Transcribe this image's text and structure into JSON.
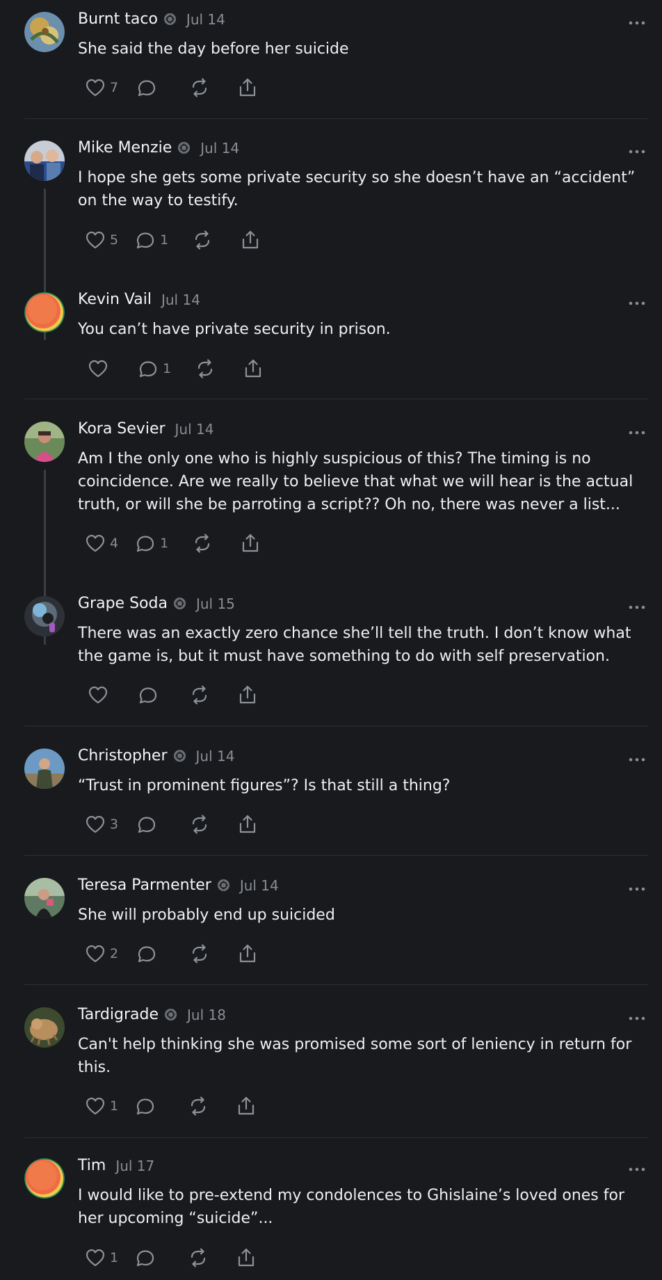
{
  "colors": {
    "background": "#181a1d",
    "text": "#f3f5f7",
    "muted": "#8a8e93",
    "divider": "#2c2f33",
    "thread_line": "#3b3e43"
  },
  "icons": {
    "like": "heart-icon",
    "reply": "comment-bubble-icon",
    "repost": "repost-arrows-icon",
    "share": "share-upload-icon",
    "more": "more-dots-icon",
    "verified": "verified-badge-icon"
  },
  "posts": [
    {
      "name": "Burnt taco",
      "verified": true,
      "date": "Jul 14",
      "body": "She said the day before her suicide",
      "likes": "7",
      "replies": ""
    },
    {
      "name": "Mike Menzie",
      "verified": true,
      "date": "Jul 14",
      "body": "I hope she gets some private security so she doesn’t have an “accident” on the way to testify.",
      "likes": "5",
      "replies": "1"
    },
    {
      "name": "Kevin Vail",
      "verified": false,
      "date": "Jul 14",
      "body": "You can’t have private security in prison.",
      "likes": "",
      "replies": "1"
    },
    {
      "name": "Kora Sevier",
      "verified": false,
      "date": "Jul 14",
      "body": "Am I the only one who is highly suspicious of this? The timing is no coincidence. Are we really to believe that what we will hear is the actual truth, or will she be parroting a script?? Oh no, there was never a list...",
      "likes": "4",
      "replies": "1"
    },
    {
      "name": "Grape Soda",
      "verified": true,
      "date": "Jul 15",
      "body": "There was an exactly zero chance she’ll tell the truth. I don’t know what the game is, but it must have something to do with self preservation.",
      "likes": "",
      "replies": ""
    },
    {
      "name": "Christopher",
      "verified": true,
      "date": "Jul 14",
      "body": "“Trust in prominent figures”? Is that still a thing?",
      "likes": "3",
      "replies": ""
    },
    {
      "name": "Teresa Parmenter",
      "verified": true,
      "date": "Jul 14",
      "body": "She will probably end up suicided",
      "likes": "2",
      "replies": ""
    },
    {
      "name": "Tardigrade",
      "verified": true,
      "date": "Jul 18",
      "body": "Can't help thinking she was promised some sort of leniency in return for this.",
      "likes": "1",
      "replies": ""
    },
    {
      "name": "Tim",
      "verified": false,
      "date": "Jul 17",
      "body": "I would like to pre-extend my condolences to Ghislaine’s loved ones for her upcoming “suicide”...",
      "likes": "1",
      "replies": ""
    }
  ]
}
